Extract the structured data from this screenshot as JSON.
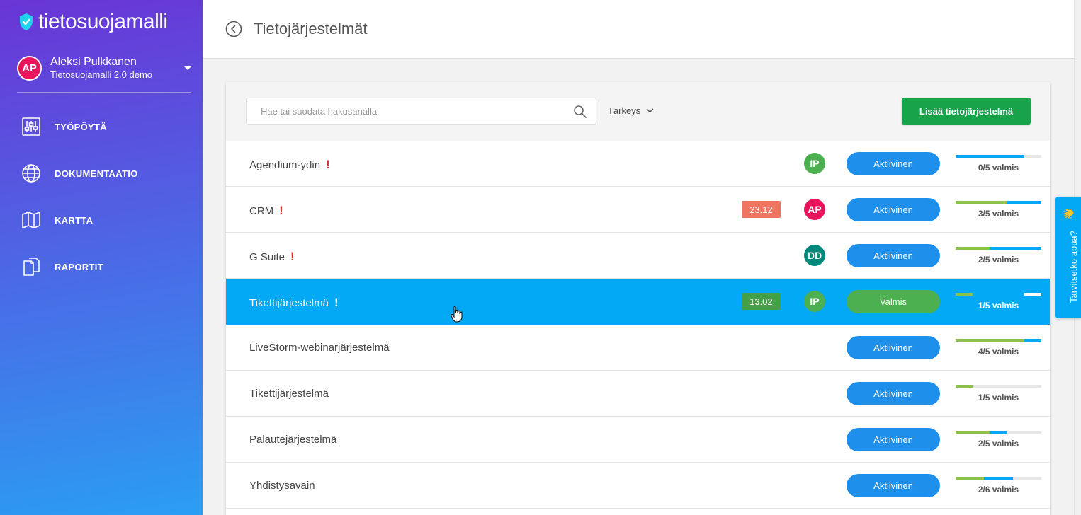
{
  "brand": {
    "name": "tietosuojamalli"
  },
  "user": {
    "initials": "AP",
    "name": "Aleksi Pulkkanen",
    "org": "Tietosuojamalli 2.0 demo"
  },
  "nav": [
    {
      "label": "TYÖPÖYTÄ",
      "icon": "sliders-icon"
    },
    {
      "label": "DOKUMENTAATIO",
      "icon": "globe-icon"
    },
    {
      "label": "KARTTA",
      "icon": "map-icon"
    },
    {
      "label": "RAPORTIT",
      "icon": "documents-icon"
    }
  ],
  "header": {
    "title": "Tietojärjestelmät"
  },
  "toolbar": {
    "search_placeholder": "Hae tai suodata hakusanalla",
    "sort_label": "Tärkeys",
    "add_label": "Lisää tietojärjestelmä"
  },
  "colors": {
    "green": "#8bc34a",
    "blue": "#03a9f4",
    "active": "#1e90ec",
    "done": "#4caf50",
    "date_red": "#ef7461",
    "date_green": "#43a047"
  },
  "systems": [
    {
      "name": "Agendium-ydin",
      "important": true,
      "date": "",
      "date_color": "",
      "user": "IP",
      "user_color": "#4caf50",
      "status": "Aktiivinen",
      "status_color": "#1e90ec",
      "progress_label": "0/5 valmis",
      "green": 0,
      "blue": 0.8,
      "selected": false
    },
    {
      "name": "CRM",
      "important": true,
      "date": "23.12",
      "date_color": "#ef7461",
      "user": "AP",
      "user_color": "#e8155c",
      "status": "Aktiivinen",
      "status_color": "#1e90ec",
      "progress_label": "3/5 valmis",
      "green": 0.6,
      "blue": 0.4,
      "selected": false
    },
    {
      "name": "G Suite",
      "important": true,
      "date": "",
      "date_color": "",
      "user": "DD",
      "user_color": "#00897b",
      "status": "Aktiivinen",
      "status_color": "#1e90ec",
      "progress_label": "2/5 valmis",
      "green": 0.4,
      "blue": 0.6,
      "selected": false
    },
    {
      "name": "Tikettijärjestelmä",
      "important": true,
      "date": "13.02",
      "date_color": "#43a047",
      "user": "IP",
      "user_color": "#4caf50",
      "status": "Valmis",
      "status_color": "#4caf50",
      "progress_label": "1/5 valmis",
      "green": 0.2,
      "blue": 0.8,
      "selected": true
    },
    {
      "name": "LiveStorm-webinarjärjestelmä",
      "important": false,
      "date": "",
      "date_color": "",
      "user": "",
      "user_color": "",
      "status": "Aktiivinen",
      "status_color": "#1e90ec",
      "progress_label": "4/5 valmis",
      "green": 0.8,
      "blue": 0.2,
      "selected": false
    },
    {
      "name": "Tikettijärjestelmä",
      "important": false,
      "date": "",
      "date_color": "",
      "user": "",
      "user_color": "",
      "status": "Aktiivinen",
      "status_color": "#1e90ec",
      "progress_label": "1/5 valmis",
      "green": 0.2,
      "blue": 0,
      "selected": false
    },
    {
      "name": "Palautejärjestelmä",
      "important": false,
      "date": "",
      "date_color": "",
      "user": "",
      "user_color": "",
      "status": "Aktiivinen",
      "status_color": "#1e90ec",
      "progress_label": "2/5 valmis",
      "green": 0.4,
      "blue": 0.2,
      "selected": false
    },
    {
      "name": "Yhdistysavain",
      "important": false,
      "date": "",
      "date_color": "",
      "user": "",
      "user_color": "",
      "status": "Aktiivinen",
      "status_color": "#1e90ec",
      "progress_label": "2/6 valmis",
      "green": 0.33,
      "blue": 0.34,
      "selected": false
    }
  ],
  "help": {
    "label": "Tarvitsetko apua?",
    "emoji": "👋"
  }
}
